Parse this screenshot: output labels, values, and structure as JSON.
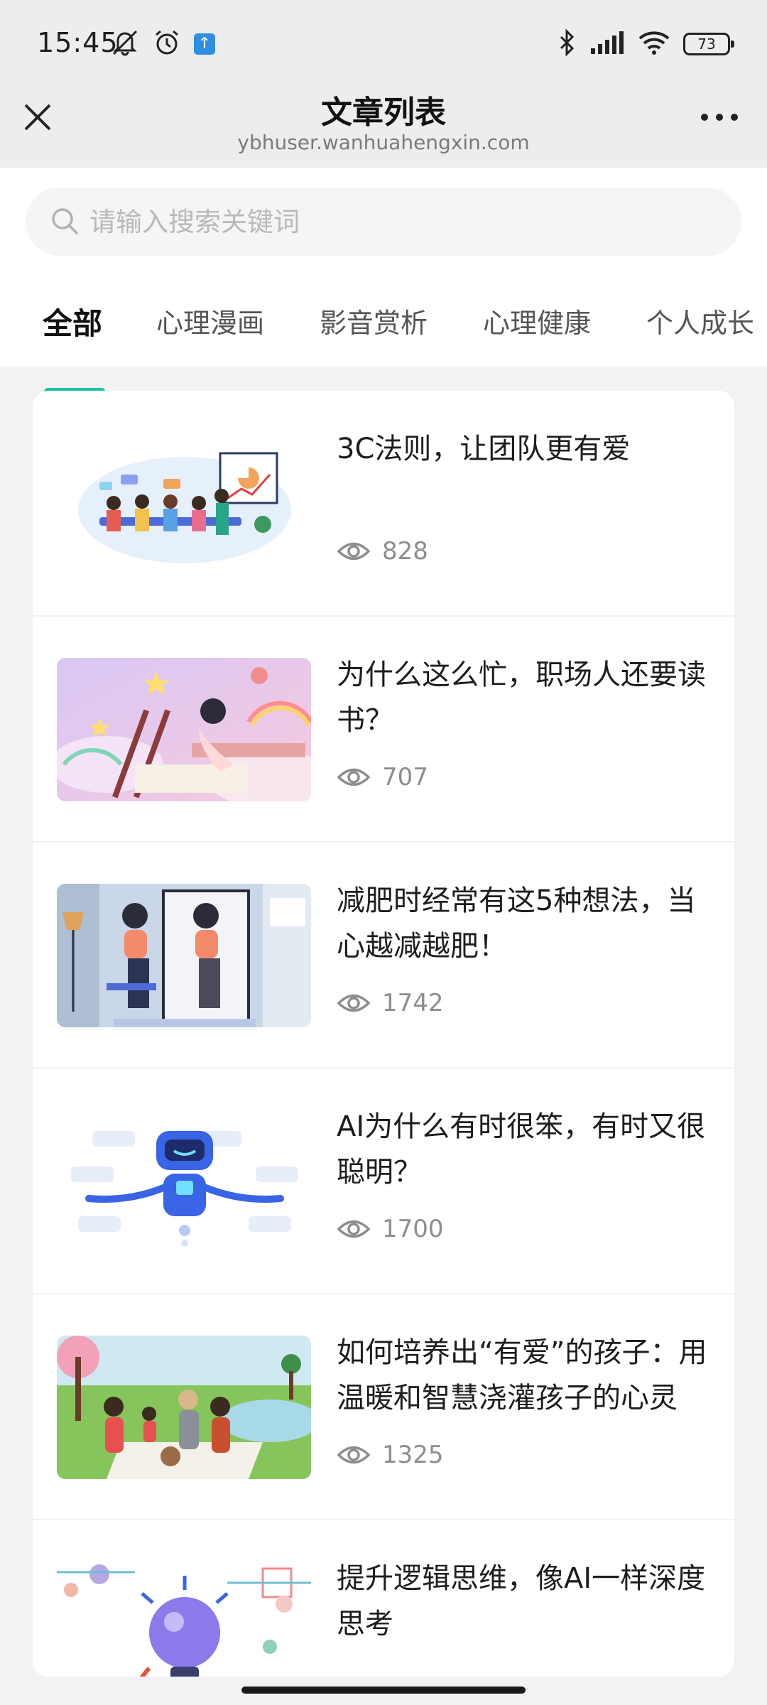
{
  "status_bar": {
    "time": "15:45",
    "battery": "73",
    "icons": [
      "mute-icon",
      "alarm-icon",
      "upload-notification-icon",
      "bluetooth-icon",
      "signal-icon",
      "wifi-icon",
      "battery-icon"
    ]
  },
  "title_bar": {
    "title": "文章列表",
    "url": "ybhuser.wanhuahengxin.com",
    "close_icon": "close-icon",
    "more_icon": "more-icon"
  },
  "search": {
    "placeholder": "请输入搜索关键词",
    "value": ""
  },
  "tabs": [
    {
      "label": "全部",
      "active": true
    },
    {
      "label": "心理漫画",
      "active": false
    },
    {
      "label": "影音赏析",
      "active": false
    },
    {
      "label": "心理健康",
      "active": false
    },
    {
      "label": "个人成长",
      "active": false
    }
  ],
  "colors": {
    "accent": "#1ec4a2",
    "page_bg": "#f2f2f2",
    "title_bar_bg": "#ededed"
  },
  "articles": [
    {
      "title": "3C法则，让团队更有爱",
      "views": "828",
      "thumbnail": "team-presentation-illustration"
    },
    {
      "title": "为什么这么忙，职场人还要读书？",
      "views": "707",
      "thumbnail": "reading-girl-rainbow-illustration"
    },
    {
      "title": "减肥时经常有这5种想法，当心越减越肥！",
      "views": "1742",
      "thumbnail": "woman-mirror-illustration"
    },
    {
      "title": "AI为什么有时很笨，有时又很聪明？",
      "views": "1700",
      "thumbnail": "robot-illustration"
    },
    {
      "title": "如何培养出“有爱”的孩子：用温暖和智慧浇灌孩子的心灵",
      "views": "1325",
      "thumbnail": "family-picnic-illustration"
    },
    {
      "title": "提升逻辑思维，像AI一样深度思考",
      "views": "",
      "thumbnail": "lightbulb-idea-illustration"
    }
  ]
}
